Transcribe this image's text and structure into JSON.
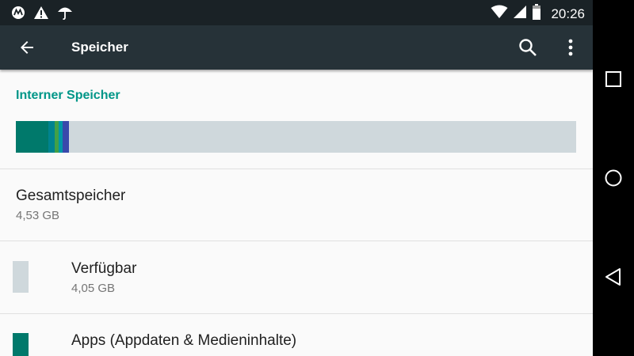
{
  "status_bar": {
    "time": "20:26",
    "left_icons": [
      "motorola-icon",
      "warning-icon",
      "umbrella-icon"
    ],
    "right_icons": [
      "wifi-icon",
      "cell-signal-icon",
      "battery-icon"
    ]
  },
  "toolbar": {
    "title": "Speicher",
    "back_icon": "arrow-back-icon",
    "search_icon": "search-icon",
    "more_icon": "more-vert-icon"
  },
  "storage": {
    "section_title": "Interner Speicher",
    "bar_background": "#cfd8dc",
    "segments": [
      {
        "color": "#00796b",
        "fraction": 0.058
      },
      {
        "color": "#00838f",
        "fraction": 0.011
      },
      {
        "color": "#43a047",
        "fraction": 0.008
      },
      {
        "color": "#0097a7",
        "fraction": 0.007
      },
      {
        "color": "#3949ab",
        "fraction": 0.011
      }
    ],
    "total": {
      "label": "Gesamtspeicher",
      "value": "4,53 GB"
    },
    "items": [
      {
        "label": "Verfügbar",
        "value": "4,05 GB",
        "color": "#cfd8dc"
      },
      {
        "label": "Apps (Appdaten & Medieninhalte)",
        "value": "",
        "color": "#00796b"
      }
    ]
  },
  "navigation_bar": {
    "buttons": [
      "recents-icon",
      "home-icon",
      "back-icon"
    ]
  },
  "colors": {
    "accent": "#009688",
    "toolbar": "#263238",
    "status_bar": "#1a2226"
  }
}
